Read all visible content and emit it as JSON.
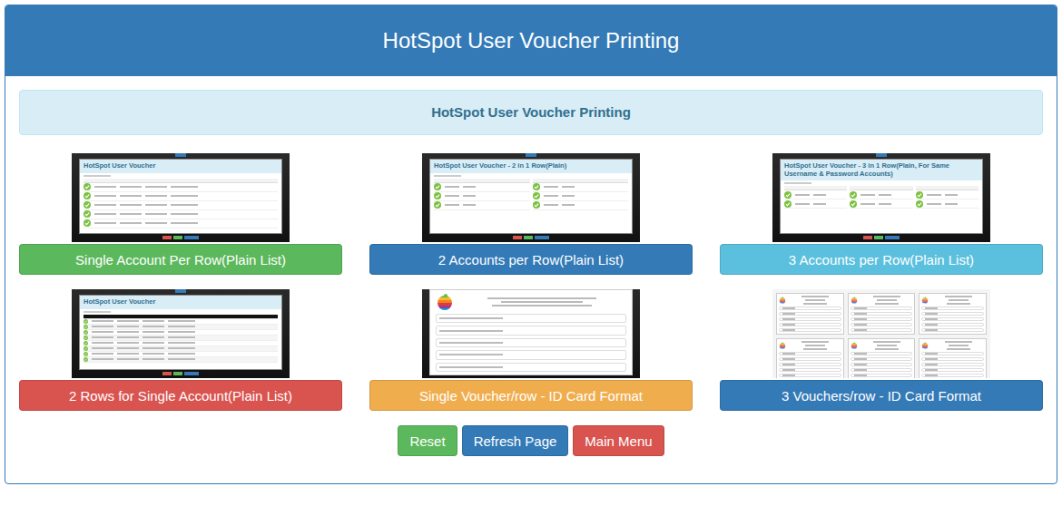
{
  "header": {
    "title": "HotSpot User Voucher Printing"
  },
  "alert": {
    "text": "HotSpot User Voucher Printing"
  },
  "options": [
    {
      "label": "Single Account Per Row(Plain List)",
      "color": "#5cb85c",
      "preview": {
        "kind": "table",
        "title": "HotSpot User Voucher",
        "groups": 1,
        "rows": 5,
        "dark_header": false
      }
    },
    {
      "label": "2 Accounts per Row(Plain List)",
      "color": "#337ab7",
      "preview": {
        "kind": "table",
        "title": "HotSpot User Voucher - 2 in 1 Row(Plain)",
        "groups": 2,
        "rows": 3,
        "dark_header": false
      }
    },
    {
      "label": "3 Accounts per Row(Plain List)",
      "color": "#5bc0de",
      "preview": {
        "kind": "table",
        "title": "HotSpot User Voucher - 3 in 1 Row(Plain, For Same Username & Password Accounts)",
        "groups": 3,
        "rows": 2,
        "dark_header": false
      }
    },
    {
      "label": "2 Rows for Single Account(Plain List)",
      "color": "#d9534f",
      "preview": {
        "kind": "table",
        "title": "HotSpot User Voucher",
        "groups": 1,
        "rows": 8,
        "dark_header": true
      }
    },
    {
      "label": "Single Voucher/row - ID Card Format",
      "color": "#f0ad4e",
      "preview": {
        "kind": "card",
        "per_row": 1,
        "cards": 1,
        "fields": 5
      }
    },
    {
      "label": "3 Vouchers/row - ID Card Format",
      "color": "#337ab7",
      "preview": {
        "kind": "card",
        "per_row": 3,
        "cards": 6,
        "fields": 5
      }
    }
  ],
  "actions": [
    {
      "label": "Reset",
      "color": "#5cb85c"
    },
    {
      "label": "Refresh Page",
      "color": "#337ab7"
    },
    {
      "label": "Main Menu",
      "color": "#d9534f"
    }
  ]
}
